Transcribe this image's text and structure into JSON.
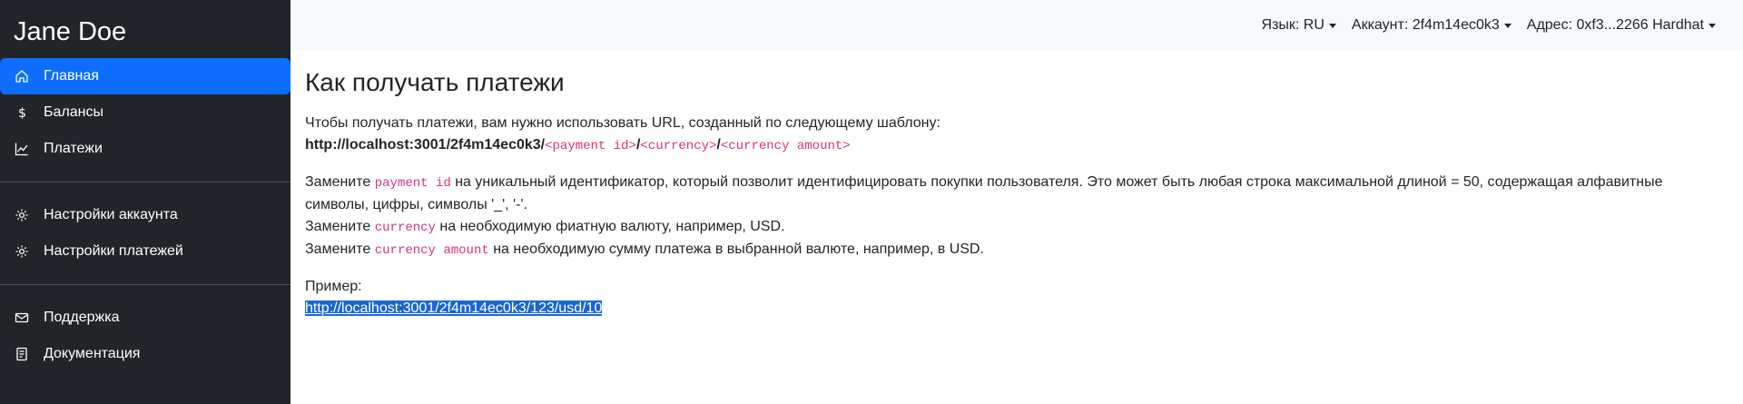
{
  "sidebar": {
    "brand": "Jane Doe",
    "items_main": [
      {
        "label": "Главная",
        "icon": "home-icon",
        "active": true
      },
      {
        "label": "Балансы",
        "icon": "dollar-icon"
      },
      {
        "label": "Платежи",
        "icon": "chart-line-icon"
      }
    ],
    "items_settings": [
      {
        "label": "Настройки аккаунта",
        "icon": "gear-icon"
      },
      {
        "label": "Настройки платежей",
        "icon": "gear-icon"
      }
    ],
    "items_help": [
      {
        "label": "Поддержка",
        "icon": "envelope-icon"
      },
      {
        "label": "Документация",
        "icon": "document-icon"
      }
    ]
  },
  "topbar": {
    "language": "Язык: RU",
    "account": "Аккаунт: 2f4m14ec0k3",
    "address": "Адрес: 0xf3...2266 Hardhat"
  },
  "main": {
    "title": "Как получать платежи",
    "intro": "Чтобы получать платежи, вам нужно использовать URL, созданный по следующему шаблону:",
    "url_base": "http://localhost:3001/2f4m14ec0k3/",
    "tpl_payment_id": "<payment id>",
    "slash": "/",
    "tpl_currency": "<currency>",
    "tpl_amount": "<currency amount>",
    "replace_word": "Замените",
    "code_payment_id": "payment id",
    "desc_payment_id": "на уникальный идентификатор, который позволит идентифицировать покупки пользователя. Это может быть любая строка максимальной длиной = 50, содержащая алфавитные символы, цифры, символы '_', '-'.",
    "code_currency": "currency",
    "desc_currency": "на необходимую фиатную валюту, например, USD.",
    "code_amount": "currency amount",
    "desc_amount": "на необходимую сумму платежа в выбранной валюте, например, в USD.",
    "example_label": "Пример:",
    "example_url": "http://localhost:3001/2f4m14ec0k3/123/usd/10"
  }
}
